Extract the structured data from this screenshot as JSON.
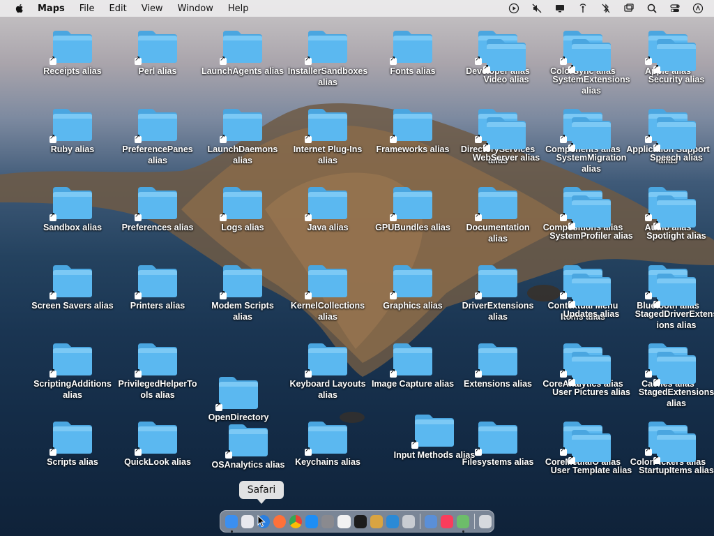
{
  "menubar": {
    "apple_icon": "apple-logo-icon",
    "app_name": "Maps",
    "menus": [
      "File",
      "Edit",
      "View",
      "Window",
      "Help"
    ],
    "status_icons": [
      "play-circle-icon",
      "muted-icon",
      "display-icon",
      "antenna-icon",
      "bluetooth-off-icon",
      "screen-mirror-icon",
      "search-icon",
      "control-center-icon",
      "user-circle-icon"
    ]
  },
  "colors": {
    "folder_top": "#7cc9f5",
    "folder_body": "#5bb8f0",
    "folder_tab": "#4aa6e0"
  },
  "desktop": {
    "icons": [
      {
        "label": "Receipts alias"
      },
      {
        "label": "Perl alias"
      },
      {
        "label": "LaunchAgents alias"
      },
      {
        "label": "InstallerSandboxes alias"
      },
      {
        "label": "Fonts alias"
      },
      {
        "label": "Developer alias"
      },
      {
        "label": "Video alias"
      },
      {
        "label": "ColorSync alias"
      },
      {
        "label": "SystemExtensions alias"
      },
      {
        "label": "Apple alias"
      },
      {
        "label": "Security alias"
      },
      {
        "label": "Ruby alias"
      },
      {
        "label": "PreferencePanes alias"
      },
      {
        "label": "LaunchDaemons alias"
      },
      {
        "label": "Internet Plug-Ins alias"
      },
      {
        "label": "Frameworks alias"
      },
      {
        "label": "DirectoryServices alias"
      },
      {
        "label": "WebServer alias"
      },
      {
        "label": "Components alias"
      },
      {
        "label": "SystemMigration alias"
      },
      {
        "label": "Application Support alias"
      },
      {
        "label": "Speech alias"
      },
      {
        "label": "Sandbox alias"
      },
      {
        "label": "Preferences alias"
      },
      {
        "label": "Logs alias"
      },
      {
        "label": "Java alias"
      },
      {
        "label": "GPUBundles alias"
      },
      {
        "label": "Documentation alias"
      },
      {
        "label": "Compositions alias"
      },
      {
        "label": "SystemProfiler alias"
      },
      {
        "label": "Audio alias"
      },
      {
        "label": "Spotlight alias"
      },
      {
        "label": "Screen Savers alias"
      },
      {
        "label": "Printers alias"
      },
      {
        "label": "Modem Scripts alias"
      },
      {
        "label": "KernelCollections alias"
      },
      {
        "label": "Graphics alias"
      },
      {
        "label": "DriverExtensions alias"
      },
      {
        "label": "Contextual Menu Items alias"
      },
      {
        "label": "Updates alias"
      },
      {
        "label": "Bluetooth alias"
      },
      {
        "label": "StagedDriverExtensions alias"
      },
      {
        "label": "ScriptingAdditions alias"
      },
      {
        "label": "PrivilegedHelperTools alias"
      },
      {
        "label": "OpenDirectory"
      },
      {
        "label": "Keyboard Layouts alias"
      },
      {
        "label": "Image Capture alias"
      },
      {
        "label": "Extensions alias"
      },
      {
        "label": "CoreAnalytics alias"
      },
      {
        "label": "User Pictures alias"
      },
      {
        "label": "Caches alias"
      },
      {
        "label": "StagedExtensions alias"
      },
      {
        "label": "Scripts alias"
      },
      {
        "label": "QuickLook alias"
      },
      {
        "label": "OSAnalytics alias"
      },
      {
        "label": "Keychains alias"
      },
      {
        "label": "Input Methods alias"
      },
      {
        "label": "Filesystems alias"
      },
      {
        "label": "CoreMediaIO alias"
      },
      {
        "label": "User Template alias"
      },
      {
        "label": "ColorPickers alias"
      },
      {
        "label": "StartupItems alias"
      }
    ]
  },
  "dock": {
    "tooltip": "Safari",
    "apps": [
      {
        "name": "finder-icon",
        "color": "#3b8ff0"
      },
      {
        "name": "launchpad-icon",
        "color": "#e8e8ee"
      },
      {
        "name": "safari-icon",
        "color": "#2a7fe0"
      },
      {
        "name": "firefox-icon",
        "color": "#ff7139"
      },
      {
        "name": "chrome-icon",
        "color": "#e8e8e8"
      },
      {
        "name": "app-store-icon",
        "color": "#1e8ef5"
      },
      {
        "name": "system-preferences-icon",
        "color": "#8a8a8f"
      },
      {
        "name": "textedit-icon",
        "color": "#f2f2f2"
      },
      {
        "name": "terminal-icon",
        "color": "#1c1c1c"
      },
      {
        "name": "script-editor-icon",
        "color": "#d9a441"
      },
      {
        "name": "vscode-icon",
        "color": "#2b8ad6"
      },
      {
        "name": "preview-icon",
        "color": "#c8ccd2"
      },
      {
        "name": "finder-alt-icon",
        "color": "#5a8fd8"
      },
      {
        "name": "music-icon",
        "color": "#fa3d5c"
      },
      {
        "name": "maps-icon",
        "color": "#6dbd6a"
      },
      {
        "name": "trash-icon",
        "color": "#d6d9de"
      }
    ]
  }
}
